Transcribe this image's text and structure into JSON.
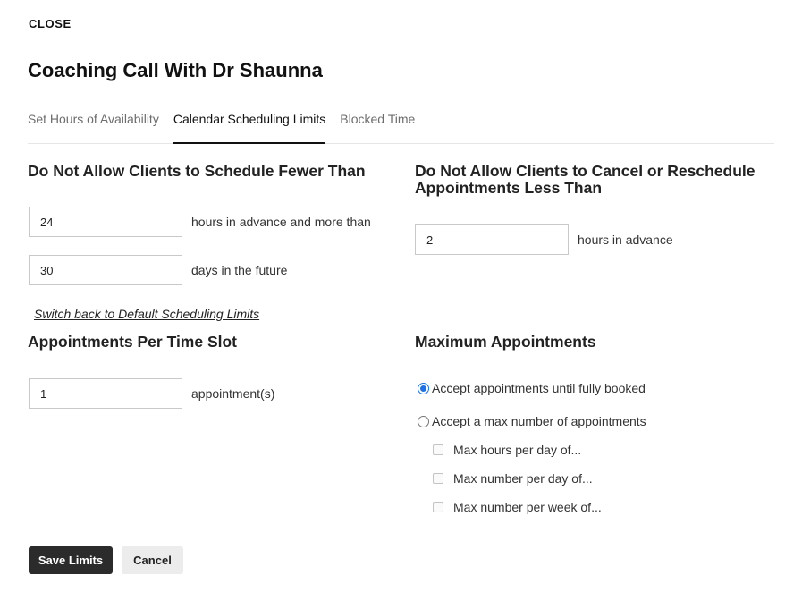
{
  "header": {
    "close_label": "CLOSE",
    "title": "Coaching Call With Dr Shaunna"
  },
  "tabs": [
    {
      "label": "Set Hours of Availability",
      "active": false
    },
    {
      "label": "Calendar Scheduling Limits",
      "active": true
    },
    {
      "label": "Blocked Time",
      "active": false
    }
  ],
  "scheduling": {
    "title": "Do Not Allow Clients to Schedule Fewer Than",
    "hours_value": "24",
    "hours_suffix": "hours in advance and more than",
    "days_value": "30",
    "days_suffix": "days in the future",
    "reset_link": "Switch back to Default Scheduling Limits"
  },
  "cancellation": {
    "title_line1": "Do Not Allow Clients to Cancel or Reschedule",
    "title_line2": "Appointments Less Than",
    "hours_value": "2",
    "hours_suffix": "hours in advance"
  },
  "per_slot": {
    "title": "Appointments Per Time Slot",
    "value": "1",
    "suffix": "appointment(s)"
  },
  "maximum": {
    "title": "Maximum Appointments",
    "options": [
      {
        "label": "Accept appointments until fully booked",
        "checked": true
      },
      {
        "label": "Accept a max number of appointments",
        "checked": false
      }
    ],
    "limits": [
      {
        "label": "Max hours per day of...",
        "checked": false
      },
      {
        "label": "Max number per day of...",
        "checked": false
      },
      {
        "label": "Max number per week of...",
        "checked": false
      }
    ]
  },
  "actions": {
    "save_label": "Save Limits",
    "cancel_label": "Cancel"
  },
  "colors": {
    "primary_button": "#2b2b2b",
    "radio_accent": "#1a73e8"
  }
}
